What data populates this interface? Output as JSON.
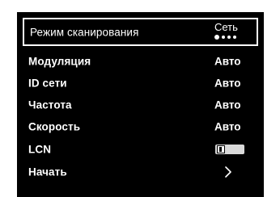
{
  "menu": {
    "selected_index": 0,
    "scan_mode": {
      "label": "Режим сканирования",
      "value": "Сеть",
      "page_dots": {
        "count": 4,
        "active": 0
      }
    },
    "items": [
      {
        "label": "Модуляция",
        "value": "Авто"
      },
      {
        "label": "ID сети",
        "value": "Авто"
      },
      {
        "label": "Частота",
        "value": "Авто"
      },
      {
        "label": "Скорость",
        "value": "Авто"
      }
    ],
    "lcn": {
      "label": "LCN",
      "state": "off",
      "icon": "toggle-switch-icon"
    },
    "start": {
      "label": "Начать",
      "icon": "chevron-right-icon"
    }
  },
  "colors": {
    "background": "#000000",
    "text": "#ffffff",
    "toggle_track": "#d9d9d9",
    "page_background": "#ffffff"
  }
}
